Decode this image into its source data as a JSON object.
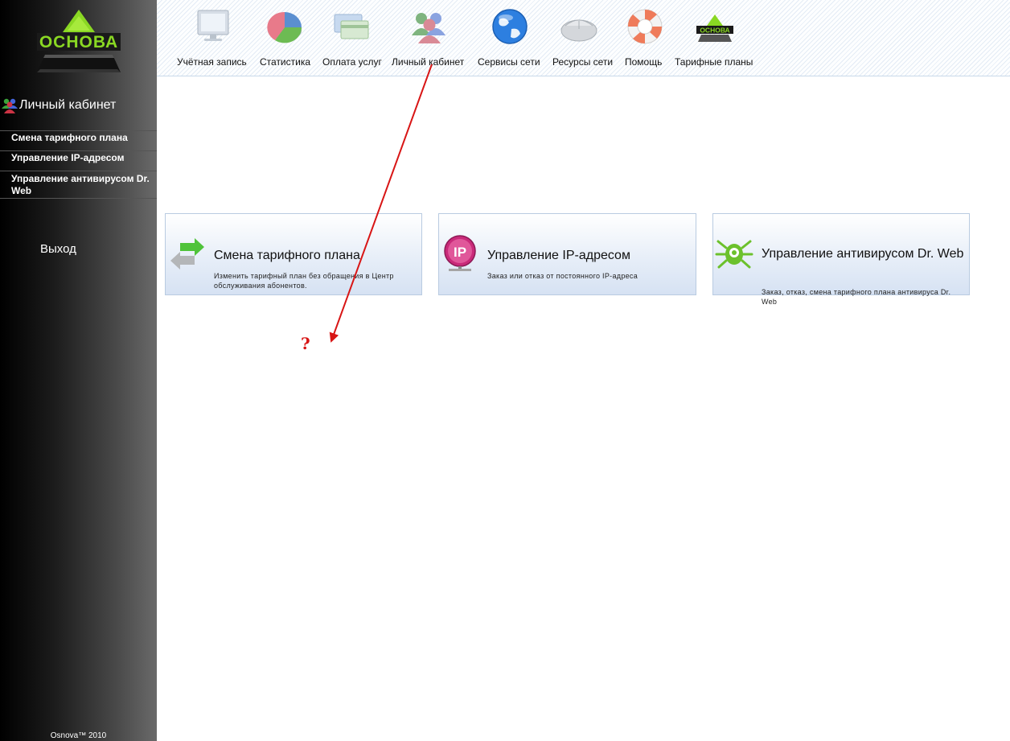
{
  "sidebar": {
    "logo_text": "ОСНОВА",
    "section_title": "Личный кабинет",
    "section_icon": "users-icon",
    "items": [
      {
        "label": "Смена тарифного плана"
      },
      {
        "label": "Управление IP-адресом"
      },
      {
        "label": "Управление антивирусом Dr. Web"
      }
    ],
    "logout_label": "Выход",
    "footer": "Osnova™ 2010"
  },
  "nav": {
    "items": [
      {
        "label": "Учётная запись",
        "icon": "monitor-icon"
      },
      {
        "label": "Статистика",
        "icon": "pie-chart-icon"
      },
      {
        "label": "Оплата услуг",
        "icon": "credit-cards-icon"
      },
      {
        "label": "Личный кабинет",
        "icon": "users-icon"
      },
      {
        "label": "Сервисы сети",
        "icon": "globe-icon"
      },
      {
        "label": "Ресурсы сети",
        "icon": "mouse-icon"
      },
      {
        "label": "Помощь",
        "icon": "lifebuoy-icon"
      },
      {
        "label": "Тарифные планы",
        "icon": "osnova-logo-icon"
      }
    ]
  },
  "cards": [
    {
      "title": "Смена тарифного плана",
      "desc": "Изменить тарифный план без обращения в Центр обслуживания абонентов.",
      "icon": "swap-arrows-icon"
    },
    {
      "title": "Управление IP-адресом",
      "desc": "Заказ или отказ от постоянного IP-адреса",
      "icon": "ip-address-icon"
    },
    {
      "title": "Управление антивирусом Dr. Web",
      "desc": "Заказ, отказ, смена тарифного плана антивируса Dr. Web",
      "icon": "drweb-spider-icon"
    }
  ],
  "annotation": {
    "text": "?",
    "color": "#d81515"
  },
  "colors": {
    "accent_green": "#7fd321",
    "sidebar_dark": "#000000",
    "card_border": "#b9cbe1"
  }
}
